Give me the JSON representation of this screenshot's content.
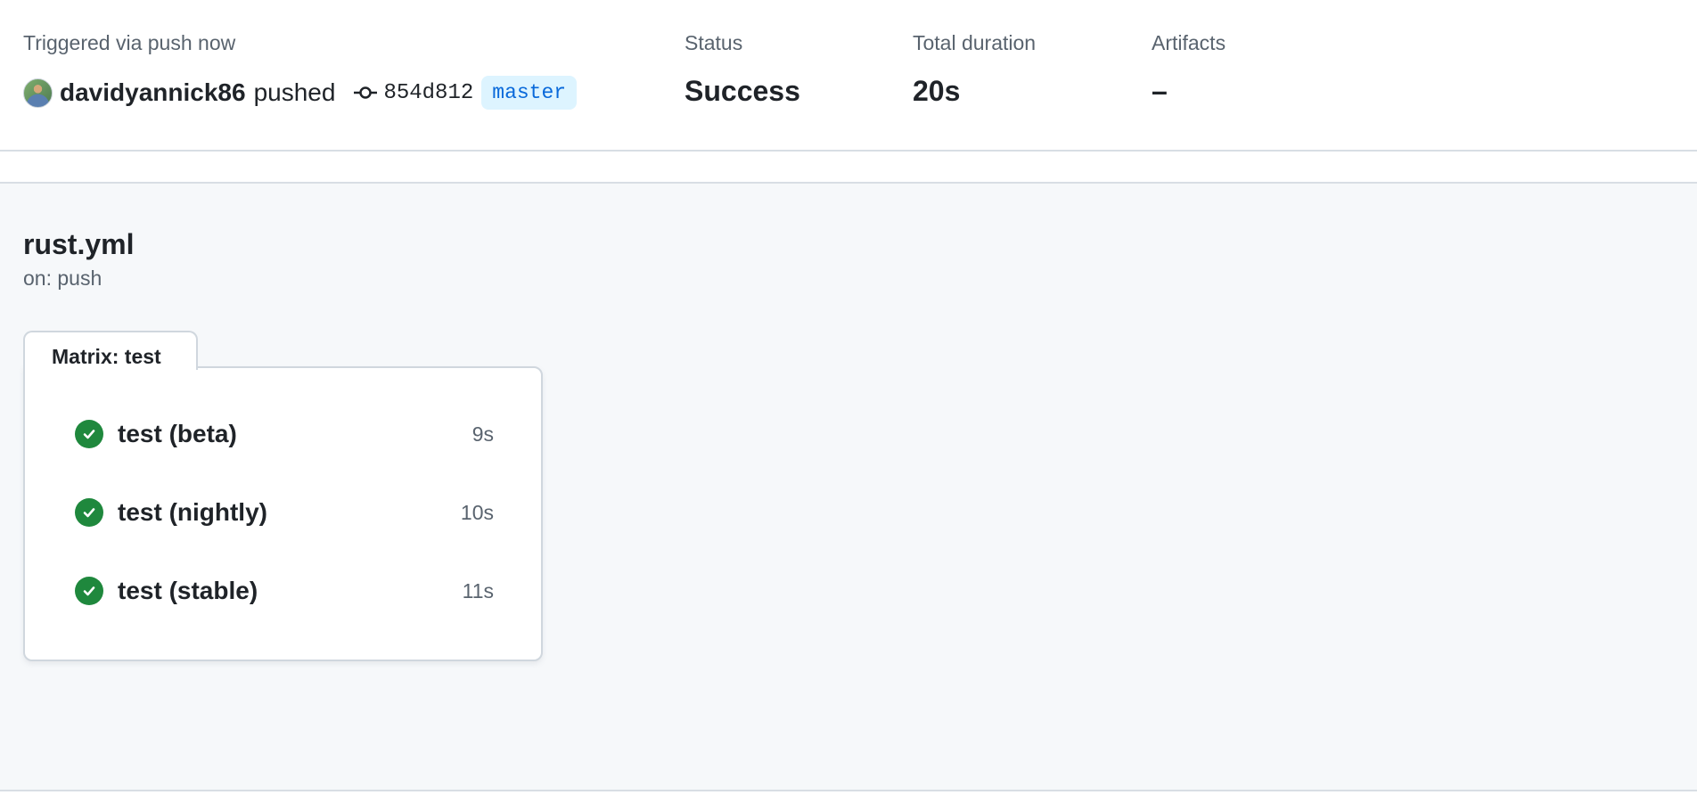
{
  "summary": {
    "trigger_label": "Triggered via push now",
    "user": "davidyannick86",
    "action": "pushed",
    "commit_sha": "854d812",
    "branch": "master",
    "status_label": "Status",
    "status_value": "Success",
    "duration_label": "Total duration",
    "duration_value": "20s",
    "artifacts_label": "Artifacts",
    "artifacts_value": "–"
  },
  "workflow": {
    "file": "rust.yml",
    "trigger": "on: push",
    "matrix_label": "Matrix: test",
    "jobs": [
      {
        "name": "test (beta)",
        "duration": "9s",
        "status": "success"
      },
      {
        "name": "test (nightly)",
        "duration": "10s",
        "status": "success"
      },
      {
        "name": "test (stable)",
        "duration": "11s",
        "status": "success"
      }
    ]
  },
  "colors": {
    "success": "#1f883d",
    "branch_bg": "#ddf4ff",
    "branch_fg": "#0969da",
    "muted": "#59636e"
  }
}
